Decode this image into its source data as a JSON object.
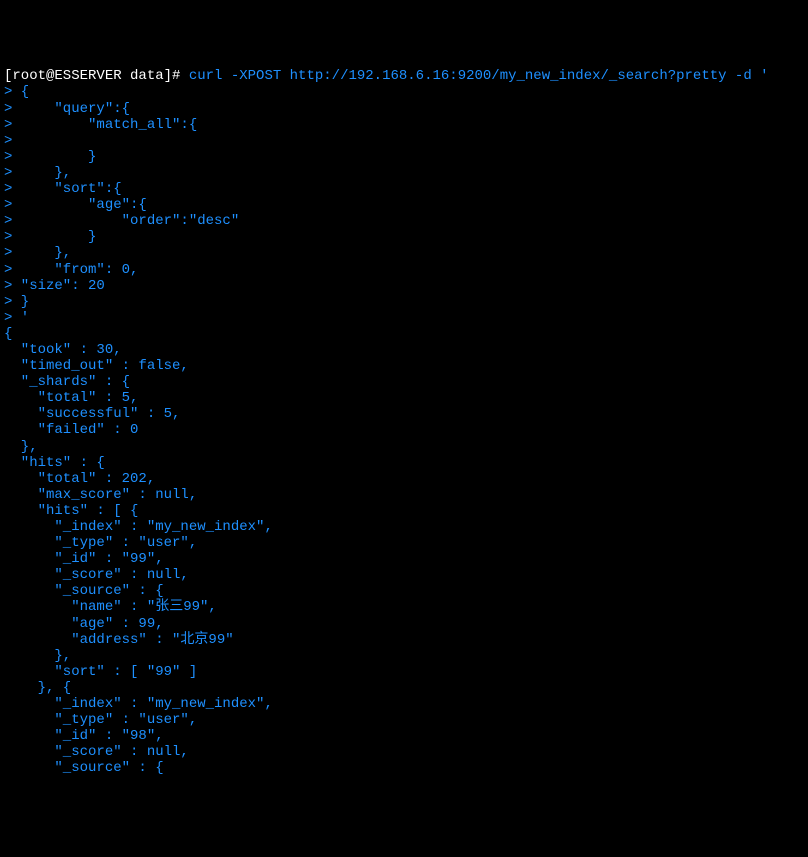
{
  "prompt": {
    "user_host": "[root@ESSERVER data]# ",
    "command": "curl -XPOST http://192.168.6.16:9200/my_new_index/_search?pretty -d '"
  },
  "input_lines": [
    "> {",
    ">     \"query\":{",
    ">         \"match_all\":{",
    ">",
    ">         }",
    ">     },",
    ">     \"sort\":{",
    ">         \"age\":{",
    ">             \"order\":\"desc\"",
    ">         }",
    ">     },",
    ">     \"from\": 0,",
    "> \"size\": 20",
    "> }",
    "> '"
  ],
  "output_lines": [
    "{",
    "  \"took\" : 30,",
    "  \"timed_out\" : false,",
    "  \"_shards\" : {",
    "    \"total\" : 5,",
    "    \"successful\" : 5,",
    "    \"failed\" : 0",
    "  },",
    "  \"hits\" : {",
    "    \"total\" : 202,",
    "    \"max_score\" : null,",
    "    \"hits\" : [ {",
    "      \"_index\" : \"my_new_index\",",
    "      \"_type\" : \"user\",",
    "      \"_id\" : \"99\",",
    "      \"_score\" : null,",
    "      \"_source\" : {",
    "        \"name\" : \"张三99\",",
    "        \"age\" : 99,",
    "        \"address\" : \"北京99\"",
    "      },",
    "      \"sort\" : [ \"99\" ]",
    "    }, {",
    "      \"_index\" : \"my_new_index\",",
    "      \"_type\" : \"user\",",
    "      \"_id\" : \"98\",",
    "      \"_score\" : null,",
    "      \"_source\" : {"
  ]
}
